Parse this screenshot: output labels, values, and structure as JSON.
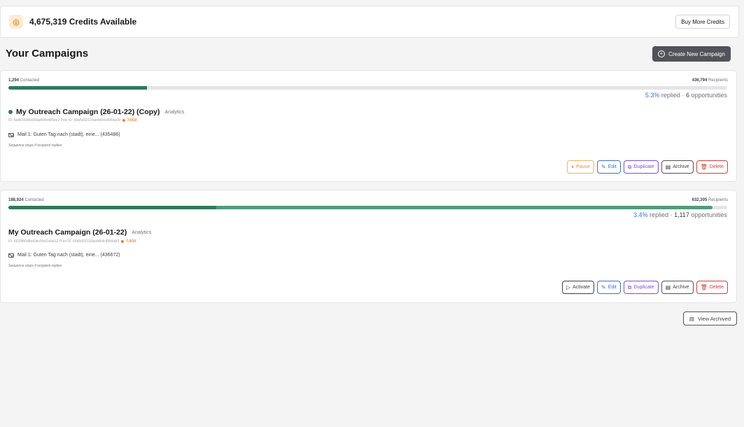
{
  "credits": {
    "icon": "coins-icon",
    "text": "4,675,319 Credits Available",
    "buy_label": "Buy More Credits"
  },
  "header": {
    "title": "Your Campaigns",
    "create_label": "Create New Campaign"
  },
  "campaigns": [
    {
      "contacted_count": "1,294",
      "contacted_label": "Contacted",
      "recipients_count": "436,794",
      "recipients_label": "Recipients",
      "progress_fraction": 0.193,
      "reply_rate": "5.3%",
      "stats_mid": " replied · ",
      "opportunities": "6",
      "opportunities_label": " opportunities",
      "name": "My Outreach Campaign (26-01-22) (Copy)",
      "analytics_label": "Analytics",
      "ids": "ID: 6a4e1536bd39adf34e495ee2 Pool ID: 69a5d32115ae4d64c8964a69",
      "score": "7.0/10",
      "mail": "Mail 1: Guten Tag nach (stadt), eine... (435486)",
      "sequence_note": "Sequence stops if recipient replies",
      "status": "active",
      "actions": {
        "toggle": "Pause",
        "edit": "Edit",
        "duplicate": "Duplicate",
        "archive": "Archive",
        "delete": "Delete"
      }
    },
    {
      "contacted_count": "188,924",
      "contacted_label": "Contacted",
      "recipients_count": "632,305",
      "recipients_label": "Recipients",
      "progress_fraction_dark": 0.289,
      "progress_fraction_light": 0.98,
      "reply_rate": "3.4%",
      "stats_mid": " replied · ",
      "opportunities": "1,117",
      "opportunities_label": " opportunities",
      "name": "My Outreach Campaign (26-01-22)",
      "analytics_label": "Analytics",
      "ids": "ID: 6933f80a8a43ec5fa914aa12 Pool ID: 69a5d32115ae4d64c8964a69",
      "score": "7.0/10",
      "mail": "Mail 1: Guten Tag nach (stadt), eine... (436672)",
      "sequence_note": "Sequence stops if recipient replies",
      "status": "paused",
      "actions": {
        "toggle": "Activate",
        "edit": "Edit",
        "duplicate": "Duplicate",
        "archive": "Archive",
        "delete": "Delete"
      }
    }
  ],
  "view_archived_label": "View Archived",
  "colors": {
    "accent_dark": "#2c7b5b",
    "accent_light": "#4f9d7a",
    "reply_rate": "#3b6fd6",
    "score": "#e8832e"
  }
}
